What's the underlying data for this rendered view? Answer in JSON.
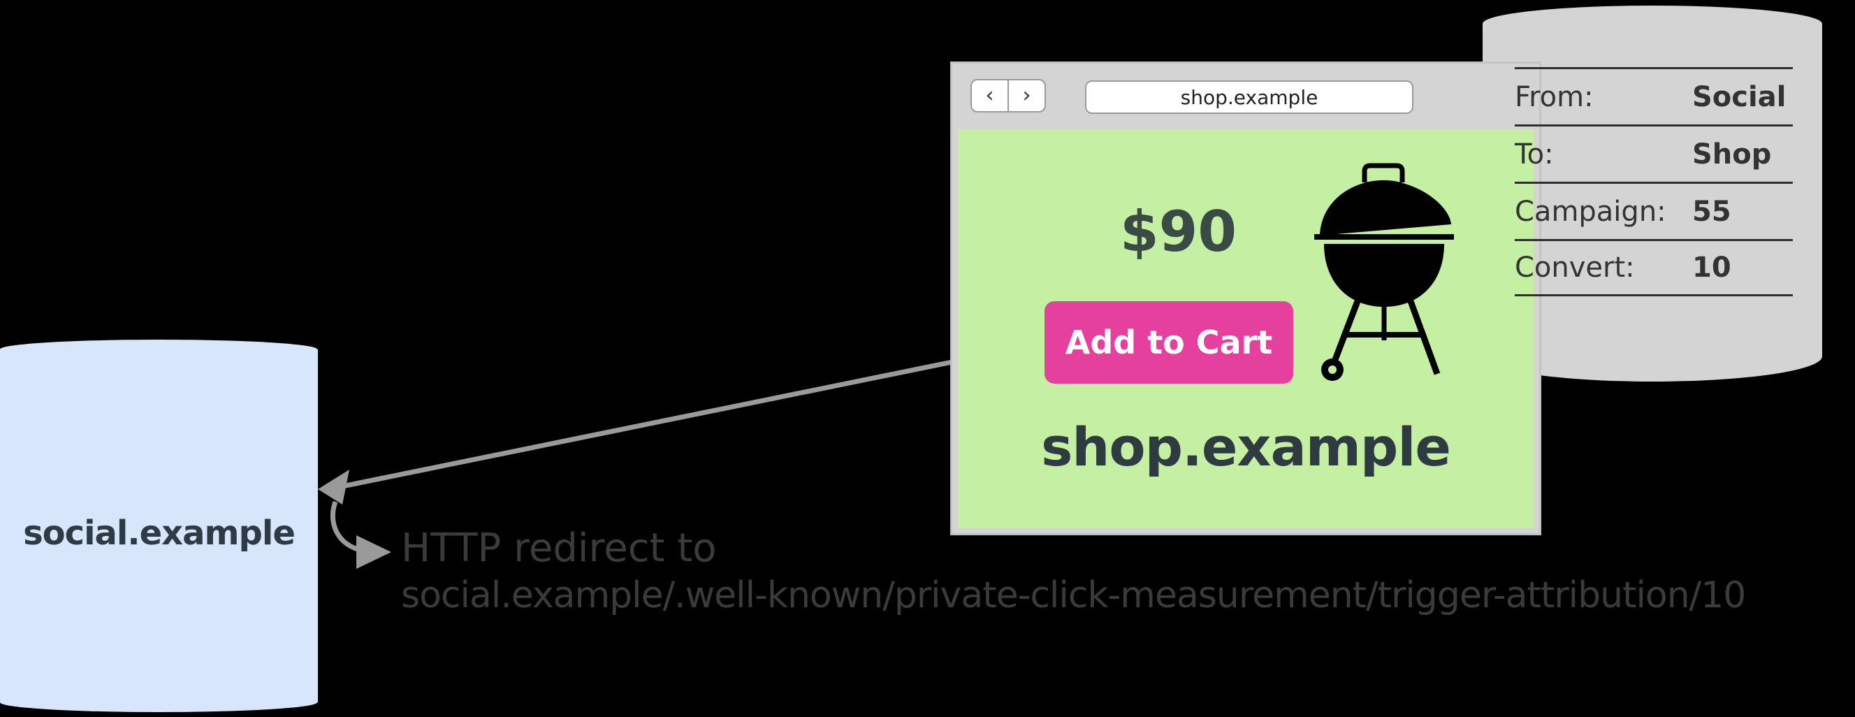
{
  "social": {
    "name": "social.example"
  },
  "browser": {
    "back_glyph": "‹",
    "forward_glyph": "›",
    "address": "shop.example"
  },
  "shop": {
    "price": "$90",
    "add_to_cart": "Add to Cart",
    "title": "shop.example",
    "product_icon": "grill-icon"
  },
  "attribution": {
    "rows": [
      {
        "key": "From:",
        "value": "Social"
      },
      {
        "key": "To:",
        "value": "Shop"
      },
      {
        "key": "Campaign:",
        "value": "55"
      },
      {
        "key": "Convert:",
        "value": "10"
      }
    ]
  },
  "redirect": {
    "line1": "HTTP redirect to",
    "line2": "social.example/.well-known/private-click-measurement/trigger-attribution/10"
  },
  "colors": {
    "background": "#000000",
    "social_cylinder": "#d8e6fb",
    "shop_page": "#c5f0a4",
    "cart_button": "#e6409e",
    "attribution_cylinder": "#d4d4d4",
    "arrow": "#9a9a9a"
  }
}
